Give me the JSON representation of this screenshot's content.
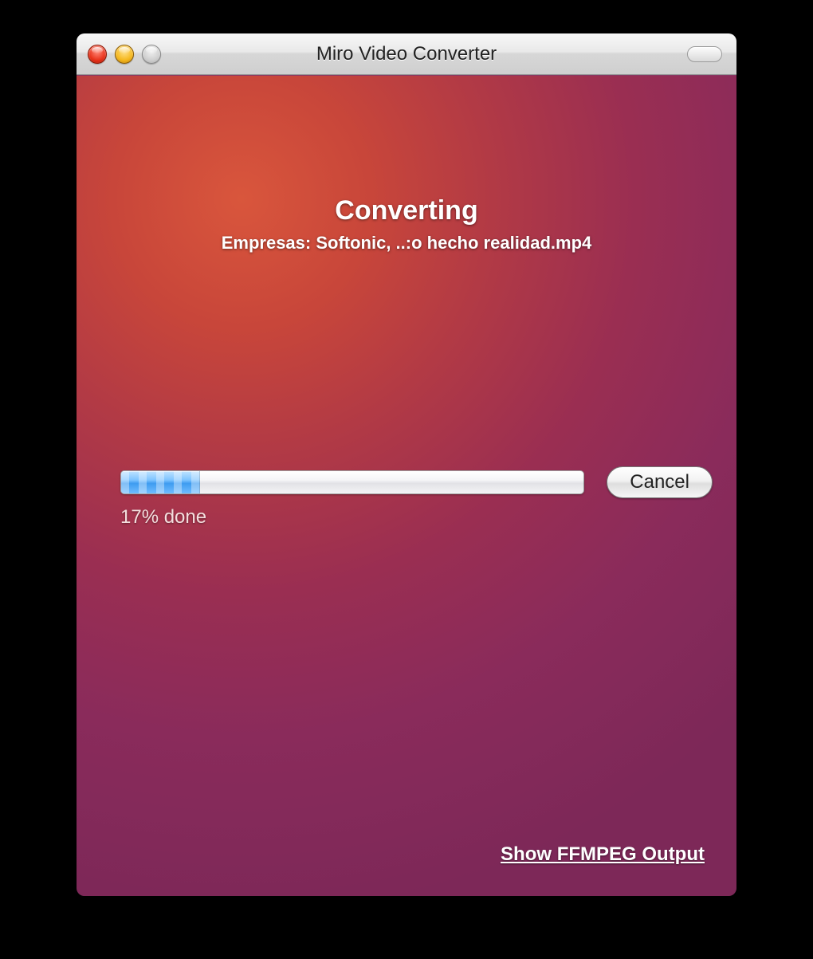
{
  "window": {
    "title": "Miro Video Converter"
  },
  "main": {
    "heading": "Converting",
    "filename": "Empresas: Softonic, ..:o hecho realidad.mp4",
    "progress_percent": 17,
    "progress_text": "17% done",
    "cancel_label": "Cancel",
    "ffmpeg_link": "Show FFMPEG Output"
  },
  "colors": {
    "progress_fill": "#5aaef5",
    "background_warm": "#c8463a",
    "background_cool": "#8a2b5b"
  }
}
